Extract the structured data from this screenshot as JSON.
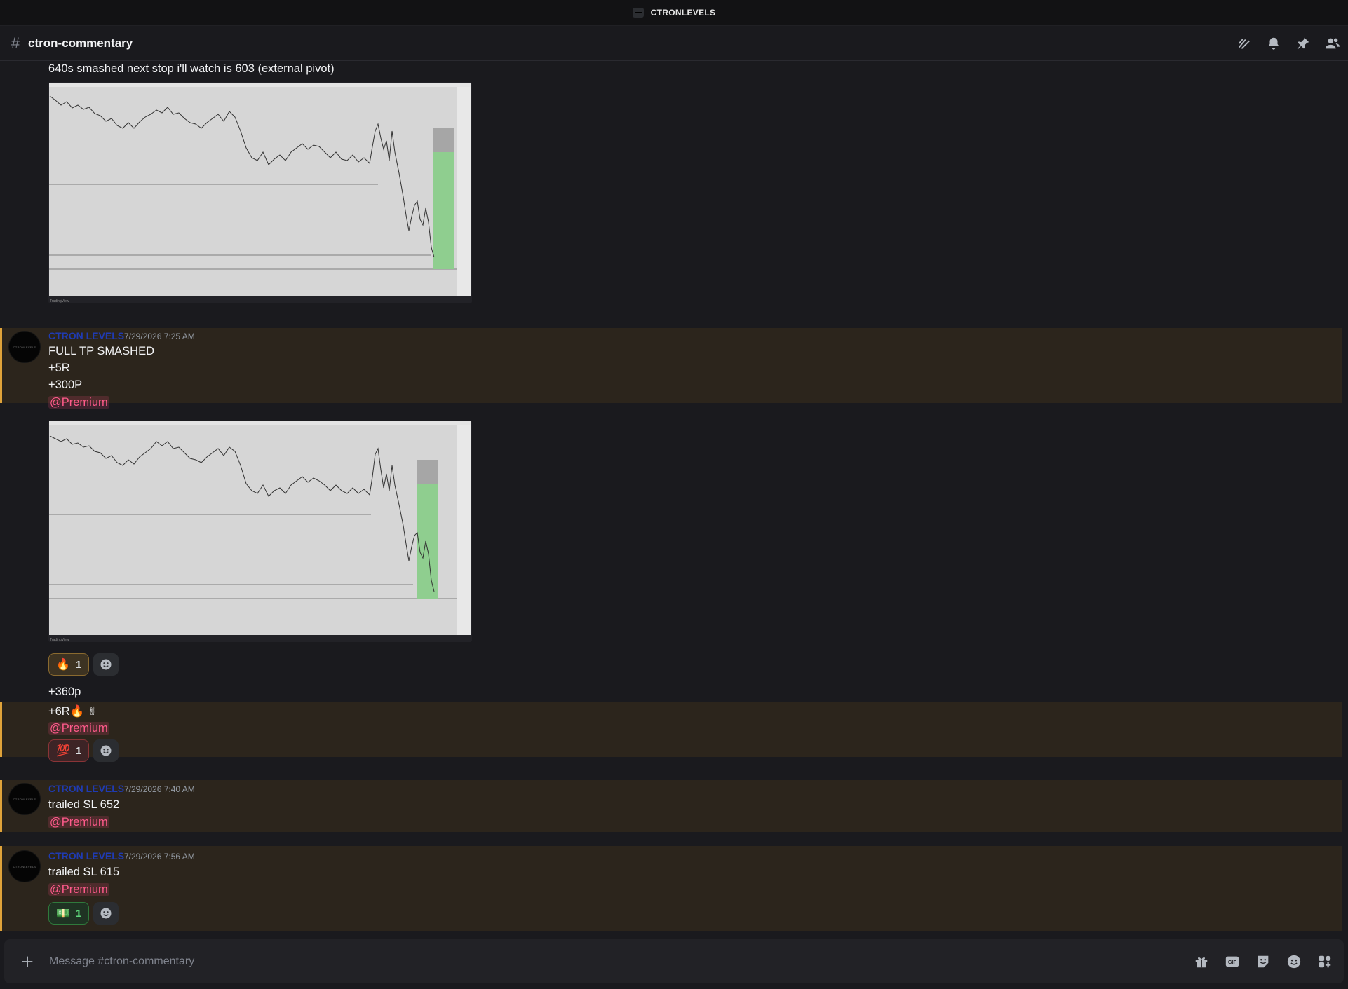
{
  "window": {
    "title": "CTRONLEVELS"
  },
  "header": {
    "channel_name": "ctron-commentary"
  },
  "messages": [
    {
      "text": "640s smashed next stop i'll watch is 603 (external pivot)",
      "image": "chart-screenshot",
      "watermark": "TradingView"
    },
    {
      "author": "CTRON LEVELS",
      "timestamp": "7/29/2026 7:25 AM",
      "lines": [
        "FULL TP SMASHED",
        "+5R",
        "+300P"
      ],
      "mention": "@Premium",
      "image": "chart-screenshot",
      "watermark": "TradingView",
      "reactions": [
        {
          "emoji": "🔥",
          "count": "1"
        }
      ]
    },
    {
      "lines": [
        "+360p",
        "+6R🔥 ✌"
      ],
      "mention": "@Premium",
      "reactions": [
        {
          "emoji": "💯",
          "count": "1"
        }
      ]
    },
    {
      "author": "CTRON LEVELS",
      "timestamp": "7/29/2026 7:40 AM",
      "lines": [
        "trailed SL 652"
      ],
      "mention": "@Premium"
    },
    {
      "author": "CTRON LEVELS",
      "timestamp": "7/29/2026 7:56 AM",
      "lines": [
        "trailed SL 615"
      ],
      "mention": "@Premium",
      "reactions": [
        {
          "emoji": "💵",
          "count": "1"
        }
      ]
    }
  ],
  "avatar_text": "CTRONLEVELS",
  "composer": {
    "placeholder": "Message #ctron-commentary"
  },
  "colors": {
    "mention_bg": "#2c251c",
    "mention_bar": "#e0a33a",
    "author": "#1f3bb3",
    "mention_text": "#ff5b8c",
    "chart_green": "#8fce8f"
  },
  "icons": {
    "header": [
      "threads-icon",
      "bell-icon",
      "pin-icon",
      "members-icon"
    ],
    "composer": [
      "gift-icon",
      "gif-icon",
      "sticker-icon",
      "emoji-icon",
      "apps-icon"
    ]
  }
}
